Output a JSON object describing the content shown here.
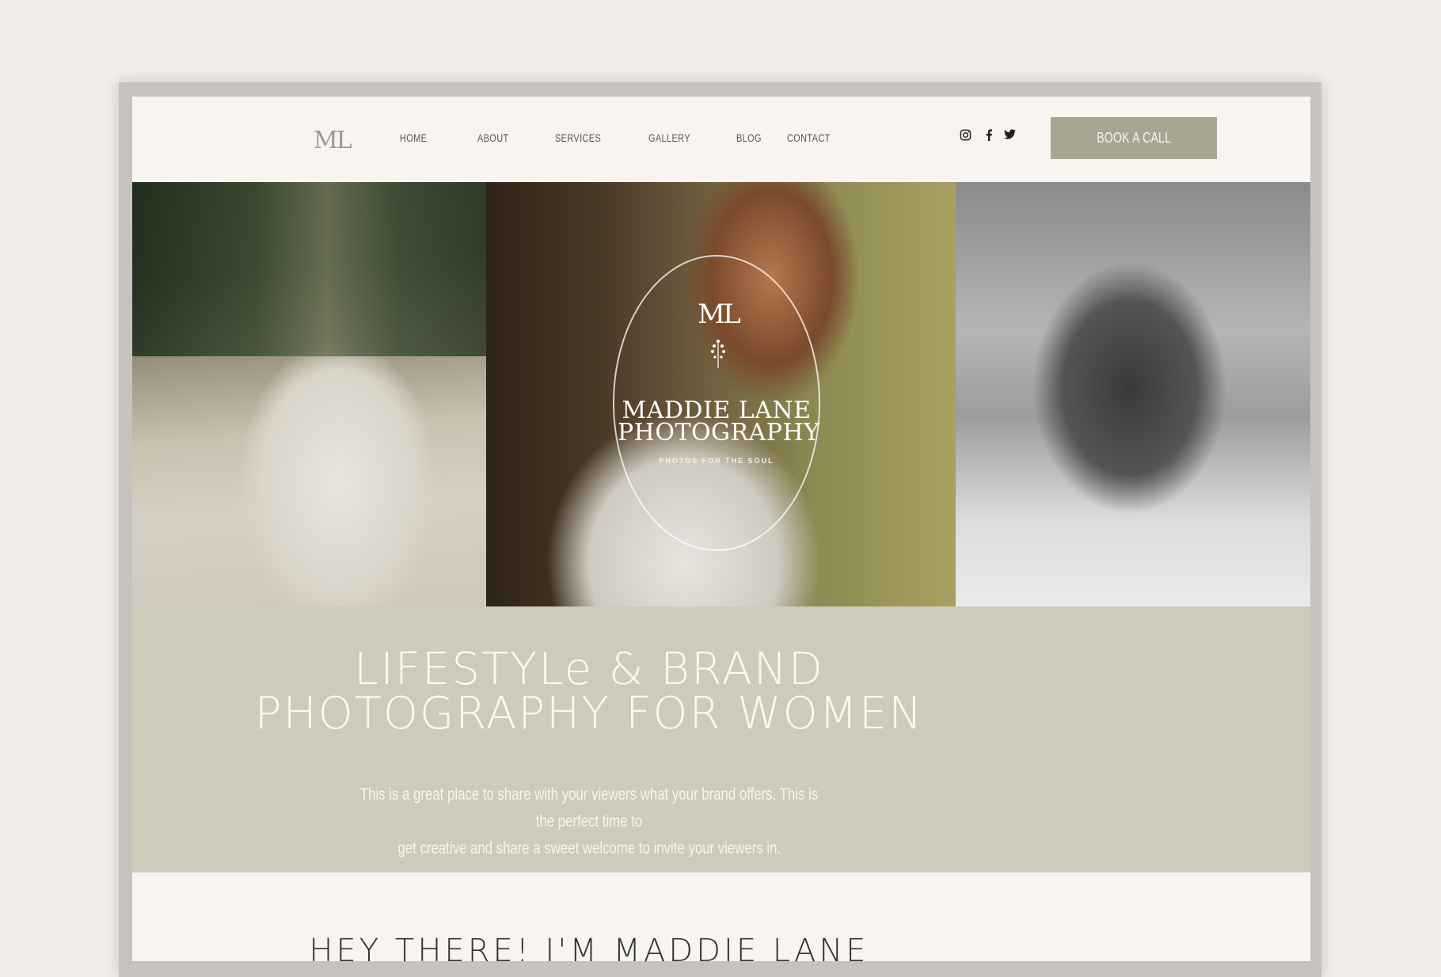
{
  "header": {
    "logo": "ML",
    "nav": [
      "HOME",
      "ABOUT",
      "SERVICES",
      "GALLERY",
      "BLOG",
      "CONTACT"
    ],
    "social_icons": [
      "instagram-icon",
      "facebook-icon",
      "twitter-icon"
    ],
    "cta_label": "BOOK A CALL"
  },
  "hero": {
    "monogram": "ML",
    "brand_line1": "MADDIE LANE",
    "brand_line2": "PHOTOGRAPHY",
    "tagline": "PHOTOS FOR THE SOUL"
  },
  "intro": {
    "headline_line1": "LIFESTYLe & BRAND",
    "headline_line2": "PHOTOGRAPHY FOR WOMEN",
    "body_line1": "This is a great place to share with your viewers what your brand offers. This is the perfect time to",
    "body_line2": "get creative and share a sweet welcome to invite your viewers in."
  },
  "about": {
    "heading": "HEY THERE! I'M MADDIE LANE"
  },
  "colors": {
    "background": "#f1eeea",
    "page": "#f8f5f0",
    "accent_sage": "#a8a693",
    "band_sage": "#cecbba"
  }
}
